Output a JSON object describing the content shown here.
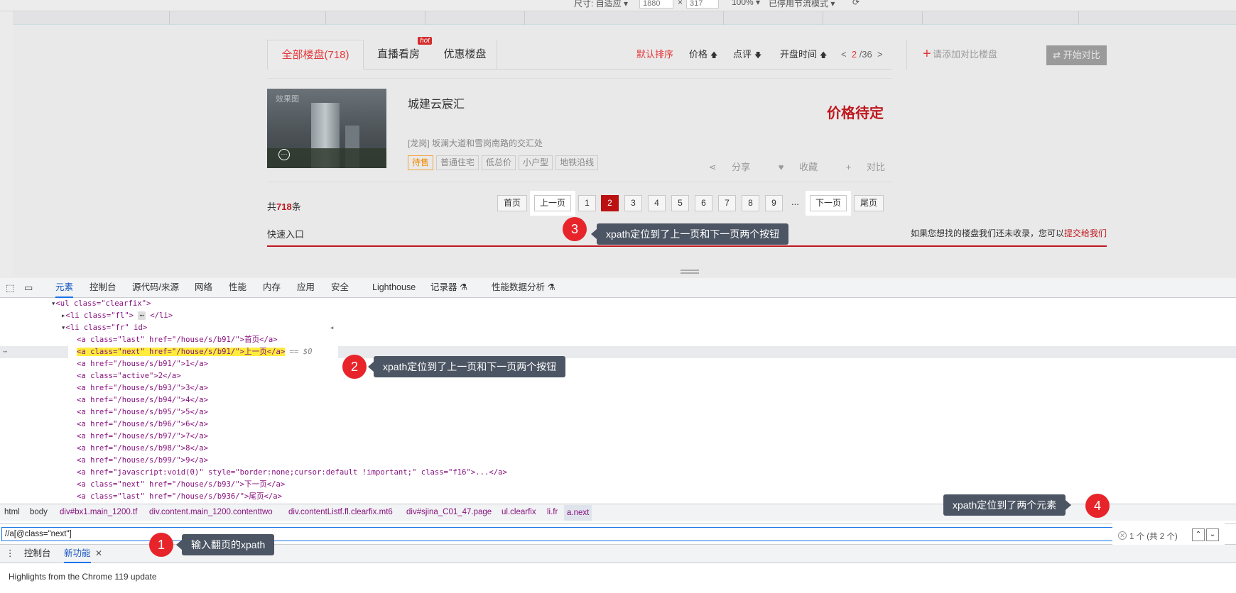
{
  "devbar": {
    "size_label": "尺寸: 自适应",
    "width_value": "1880",
    "times": "×",
    "height_value": "317",
    "zoom": "100%",
    "throttle": "已停用节流模式"
  },
  "site": {
    "tabs": [
      {
        "label": "全部楼盘(718)",
        "active": true
      },
      {
        "label": "直播看房",
        "badge": "hot"
      },
      {
        "label": "优惠楼盘"
      }
    ],
    "sort_default": "默认排序",
    "sort_price": "价格",
    "sort_review": "点评",
    "sort_open": "开盘时间",
    "page_prev_sym": "<",
    "page_current": "2",
    "page_total": "/36",
    "page_next_sym": ">",
    "compare_placeholder": "请添加对比楼盘",
    "compare_button": "开始对比",
    "listing": {
      "watermark": "效果图",
      "title": "城建云宸汇",
      "price": "价格待定",
      "address": "[龙岗] 坂澜大道和雪岗南路的交汇处",
      "tags": [
        "待售",
        "普通住宅",
        "低总价",
        "小户型",
        "地铁沿线"
      ],
      "share": "分享",
      "favorite": "收藏",
      "compare": "对比"
    },
    "total_prefix": "共",
    "total_count": "718",
    "total_suffix": "条",
    "pager": {
      "first": "首页",
      "prev": "上一页",
      "pages": [
        "1",
        "2",
        "3",
        "4",
        "5",
        "6",
        "7",
        "8",
        "9"
      ],
      "active_page": "2",
      "ellipsis": "...",
      "next": "下一页",
      "last": "尾页"
    },
    "quick_entry": "快速入口",
    "missing_text": "如果您想找的楼盘我们还未收录，您可以",
    "submit_link": "提交给我们"
  },
  "devtools": {
    "tabs": [
      "元素",
      "控制台",
      "源代码/来源",
      "网络",
      "性能",
      "内存",
      "应用",
      "安全",
      "Lighthouse",
      "记录器",
      "性能数据分析"
    ],
    "active_tab": "元素",
    "code_lines": {
      "ul_open": "<ul class=\"clearfix\">",
      "li_fl": "<li class=\"fl\">",
      "li_fl_rest": "</li>",
      "li_fr": "<li class=\"fr\" id>",
      "a_first": "<a class=\"last\" href=\"/house/s/b91/\">首页</a>",
      "a_prev": "<a class=\"next\" href=\"/house/s/b91/\">上一页</a>",
      "eq_ref": "== $0",
      "a_1": "<a href=\"/house/s/b91/\">1</a>",
      "a_2": "<a class=\"active\">2</a>",
      "a_3": "<a href=\"/house/s/b93/\">3</a>",
      "a_4": "<a href=\"/house/s/b94/\">4</a>",
      "a_5": "<a href=\"/house/s/b95/\">5</a>",
      "a_6": "<a href=\"/house/s/b96/\">6</a>",
      "a_7": "<a href=\"/house/s/b97/\">7</a>",
      "a_8": "<a href=\"/house/s/b98/\">8</a>",
      "a_9": "<a href=\"/house/s/b99/\">9</a>",
      "a_js": "<a href=\"javascript:void(0)\" style=\"border:none;cursor:default !important;\" class=\"f16\">...</a>",
      "a_next": "<a class=\"next\" href=\"/house/s/b93/\">下一页</a>",
      "a_last": "<a class=\"last\" href=\"/house/s/b936/\">尾页</a>"
    },
    "breadcrumbs": [
      "html",
      "body",
      "div#bx1.main_1200.tf",
      "div.content.main_1200.contenttwo",
      "div.contentListf.fl.clearfix.mt6",
      "div#sjina_C01_47.page",
      "ul.clearfix",
      "li.fr",
      "a.next"
    ],
    "search_value": "//a[@class=\"next\"]",
    "match_count": "1 个 (共 2 个)",
    "drawer_tabs": [
      "控制台",
      "新功能"
    ],
    "drawer_active": "新功能",
    "drawer_text": "Highlights from the Chrome 119 update"
  },
  "annotations": [
    {
      "num": "1",
      "text": "输入翻页的xpath"
    },
    {
      "num": "2",
      "text": "xpath定位到了上一页和下一页两个按钮"
    },
    {
      "num": "3",
      "text": "xpath定位到了上一页和下一页两个按钮"
    },
    {
      "num": "4",
      "text": "xpath定位到了两个元素"
    }
  ],
  "colors": {
    "accent_red": "#e4393c",
    "devtools_blue": "#1a73e8",
    "callout_bg": "#4c5563",
    "marker_red": "#e8242b"
  }
}
